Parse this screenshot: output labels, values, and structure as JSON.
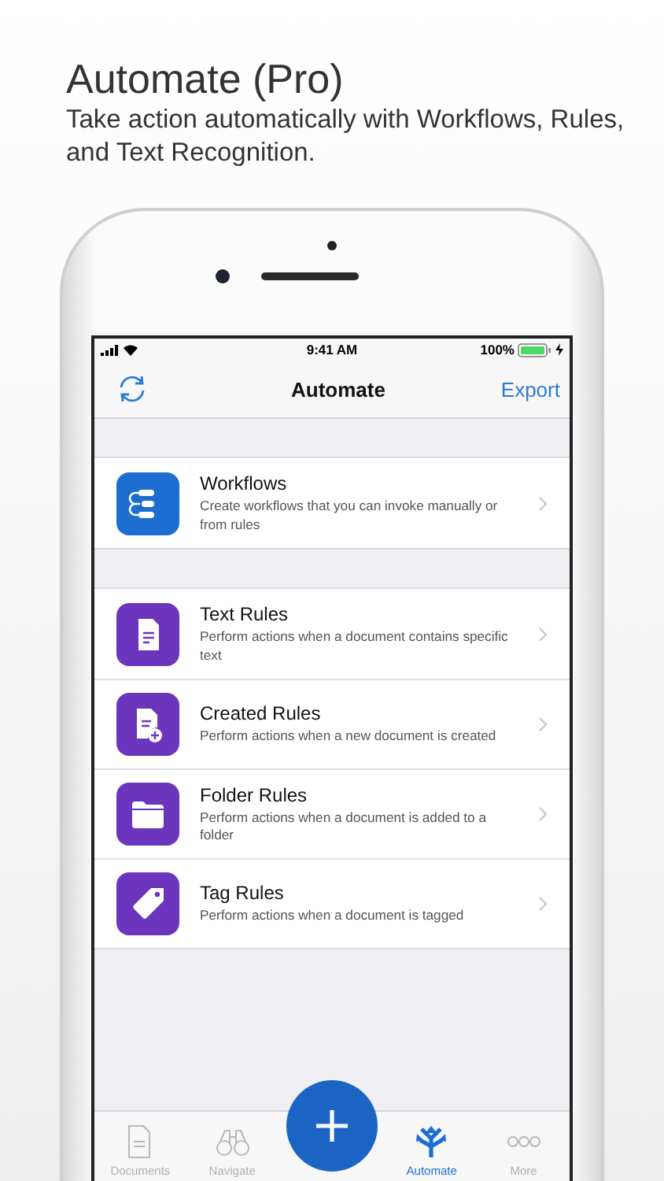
{
  "headline": {
    "title": "Automate (Pro)",
    "subtitle": "Take action automatically with Workflows, Rules, and Text Recognition."
  },
  "status_bar": {
    "time": "9:41 AM",
    "battery": "100%"
  },
  "nav_bar": {
    "title": "Automate",
    "action": "Export"
  },
  "sections": [
    {
      "rows": [
        {
          "title": "Workflows",
          "description": "Create workflows that you can invoke manually or from rules",
          "color": "#1c6fd1"
        }
      ]
    },
    {
      "rows": [
        {
          "title": "Text Rules",
          "description": "Perform actions when a document contains specific text",
          "color": "#6b36bd"
        },
        {
          "title": "Created Rules",
          "description": "Perform actions when a new document is created",
          "color": "#6b36bd"
        },
        {
          "title": "Folder Rules",
          "description": "Perform actions when a document is added to a folder",
          "color": "#6b36bd"
        },
        {
          "title": "Tag Rules",
          "description": "Perform actions when a document is tagged",
          "color": "#6b36bd"
        }
      ]
    }
  ],
  "tab_bar": [
    {
      "label": "Documents",
      "selected": false
    },
    {
      "label": "Navigate",
      "selected": false
    },
    {
      "label": "Automate",
      "selected": true
    },
    {
      "label": "More",
      "selected": false
    }
  ]
}
